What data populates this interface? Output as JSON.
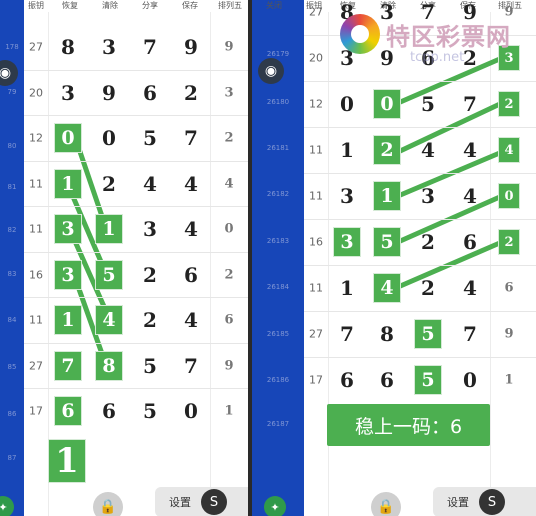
{
  "headers": [
    "振钥",
    "恢复",
    "清除",
    "分享",
    "保存",
    "排列五"
  ],
  "headers_right": [
    "关闭",
    "振钥",
    "恢复",
    "清除",
    "分享",
    "保存",
    "排列五"
  ],
  "sidebar_left": {
    "issues": [
      "178",
      "79",
      "80",
      "81",
      "82",
      "83",
      "84",
      "85",
      "86",
      "87"
    ]
  },
  "sidebar_right": {
    "issues": [
      "26179",
      "26180",
      "26181",
      "26182",
      "26183",
      "26184",
      "26185",
      "26186",
      "26187"
    ]
  },
  "left_rows": [
    {
      "n": "27",
      "d": [
        "8",
        "3",
        "7",
        "9"
      ],
      "e": "9"
    },
    {
      "n": "20",
      "d": [
        "3",
        "9",
        "6",
        "2"
      ],
      "e": "3"
    },
    {
      "n": "12",
      "d": [
        "0",
        "0",
        "5",
        "7"
      ],
      "e": "2"
    },
    {
      "n": "11",
      "d": [
        "1",
        "2",
        "4",
        "4"
      ],
      "e": "4"
    },
    {
      "n": "11",
      "d": [
        "3",
        "1",
        "3",
        "4"
      ],
      "e": "0"
    },
    {
      "n": "16",
      "d": [
        "3",
        "5",
        "2",
        "6"
      ],
      "e": "2"
    },
    {
      "n": "11",
      "d": [
        "1",
        "4",
        "2",
        "4"
      ],
      "e": "6"
    },
    {
      "n": "27",
      "d": [
        "7",
        "8",
        "5",
        "7"
      ],
      "e": "9"
    },
    {
      "n": "17",
      "d": [
        "6",
        "6",
        "5",
        "0"
      ],
      "e": "1"
    }
  ],
  "left_extra": "1",
  "right_rows": [
    {
      "n": "27",
      "d": [
        "8",
        "3",
        "7",
        "9"
      ],
      "e": "9"
    },
    {
      "n": "20",
      "d": [
        "3",
        "9",
        "6",
        "2"
      ],
      "e": "3"
    },
    {
      "n": "12",
      "d": [
        "0",
        "0",
        "5",
        "7"
      ],
      "e": "2"
    },
    {
      "n": "11",
      "d": [
        "1",
        "2",
        "4",
        "4"
      ],
      "e": "4"
    },
    {
      "n": "11",
      "d": [
        "3",
        "1",
        "3",
        "4"
      ],
      "e": "0"
    },
    {
      "n": "16",
      "d": [
        "3",
        "5",
        "2",
        "6"
      ],
      "e": "2"
    },
    {
      "n": "11",
      "d": [
        "1",
        "4",
        "2",
        "4"
      ],
      "e": "6"
    },
    {
      "n": "27",
      "d": [
        "7",
        "8",
        "5",
        "7"
      ],
      "e": "9"
    },
    {
      "n": "17",
      "d": [
        "6",
        "6",
        "5",
        "0"
      ],
      "e": "1"
    }
  ],
  "banner_text": "稳上一码：6",
  "settings_label": "设置",
  "settings_icon_letter": "S",
  "logo_text": "特区彩票网",
  "watermark": "tcpp.net",
  "colors": {
    "green": "#4caf50",
    "sidebar": "#1746b8"
  }
}
